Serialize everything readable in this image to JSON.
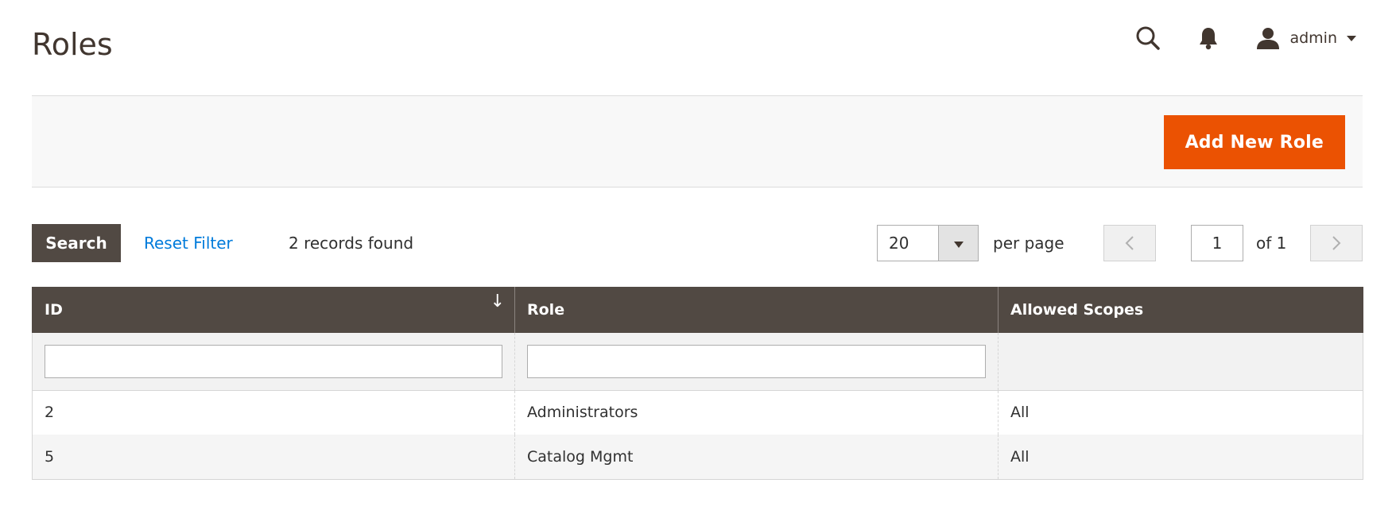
{
  "page": {
    "title": "Roles"
  },
  "header": {
    "search_icon": "search-icon",
    "notifications_icon": "bell-icon",
    "user": {
      "icon": "user-icon",
      "name": "admin"
    }
  },
  "actions": {
    "add_new_role_label": "Add New Role"
  },
  "toolbar": {
    "search_label": "Search",
    "reset_filter_label": "Reset Filter",
    "records_found": "2 records found",
    "per_page_value": "20",
    "per_page_label": "per page",
    "current_page": "1",
    "total_pages_label": "of 1"
  },
  "table": {
    "columns": [
      {
        "label": "ID",
        "sorted": "desc"
      },
      {
        "label": "Role"
      },
      {
        "label": "Allowed Scopes"
      }
    ],
    "rows": [
      {
        "id": "2",
        "role": "Administrators",
        "scopes": "All"
      },
      {
        "id": "5",
        "role": "Catalog Mgmt",
        "scopes": "All"
      }
    ]
  },
  "colors": {
    "accent": "#eb5202",
    "dark": "#514943",
    "link": "#007bdb"
  }
}
